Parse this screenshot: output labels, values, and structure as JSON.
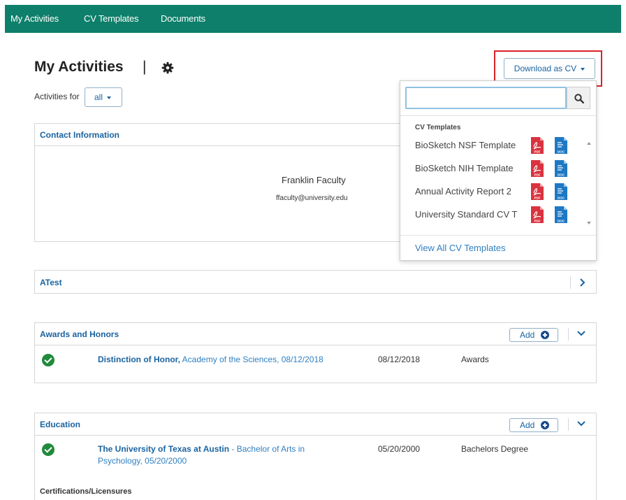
{
  "nav": {
    "items": [
      {
        "label": "My Activities"
      },
      {
        "label": "CV Templates"
      },
      {
        "label": "Documents"
      }
    ]
  },
  "header": {
    "title": "My Activities",
    "separator": "|",
    "filter_label": "Activities for",
    "filter_value": "all",
    "download_label": "Download as CV"
  },
  "contact": {
    "title": "Contact Information",
    "name": "Franklin Faculty",
    "email": "ffaculty@university.edu"
  },
  "atest": {
    "title": "ATest"
  },
  "awards": {
    "title": "Awards and Honors",
    "add_label": "Add",
    "rows": [
      {
        "title": "Distinction of Honor,",
        "detail": "Academy of the Sciences, 08/12/2018",
        "date": "08/12/2018",
        "type": "Awards"
      }
    ]
  },
  "education": {
    "title": "Education",
    "add_label": "Add",
    "rows": [
      {
        "title": "The University of Texas at Austin",
        "detail_line1": "- Bachelor of Arts in",
        "detail_line2": "Psychology, 05/20/2000",
        "date": "05/20/2000",
        "type": "Bachelors Degree"
      }
    ],
    "sub_label": "Certifications/Licensures"
  },
  "dropdown": {
    "search_value": "",
    "section_label": "CV Templates",
    "templates": [
      {
        "name": "BioSketch NSF Template"
      },
      {
        "name": "BioSketch NIH Template"
      },
      {
        "name": "Annual Activity Report 2"
      },
      {
        "name": "University Standard CV T"
      }
    ],
    "pdf_label": "PDF",
    "doc_label": "DOC",
    "view_all": "View All CV Templates"
  },
  "colors": {
    "nav_bg": "#0d7f6a",
    "link": "#1a63a0",
    "highlight": "#d8232a",
    "check": "#218a3b",
    "pdf": "#d9333f",
    "doc": "#1e78c4"
  },
  "icons": {
    "settings": "gear-icon",
    "search": "search-icon",
    "status": "check-circle-icon",
    "expand": "chevron-down-icon",
    "open": "chevron-right-icon",
    "add": "plus-circle-icon",
    "pdf": "pdf-file-icon",
    "doc": "doc-file-icon"
  }
}
